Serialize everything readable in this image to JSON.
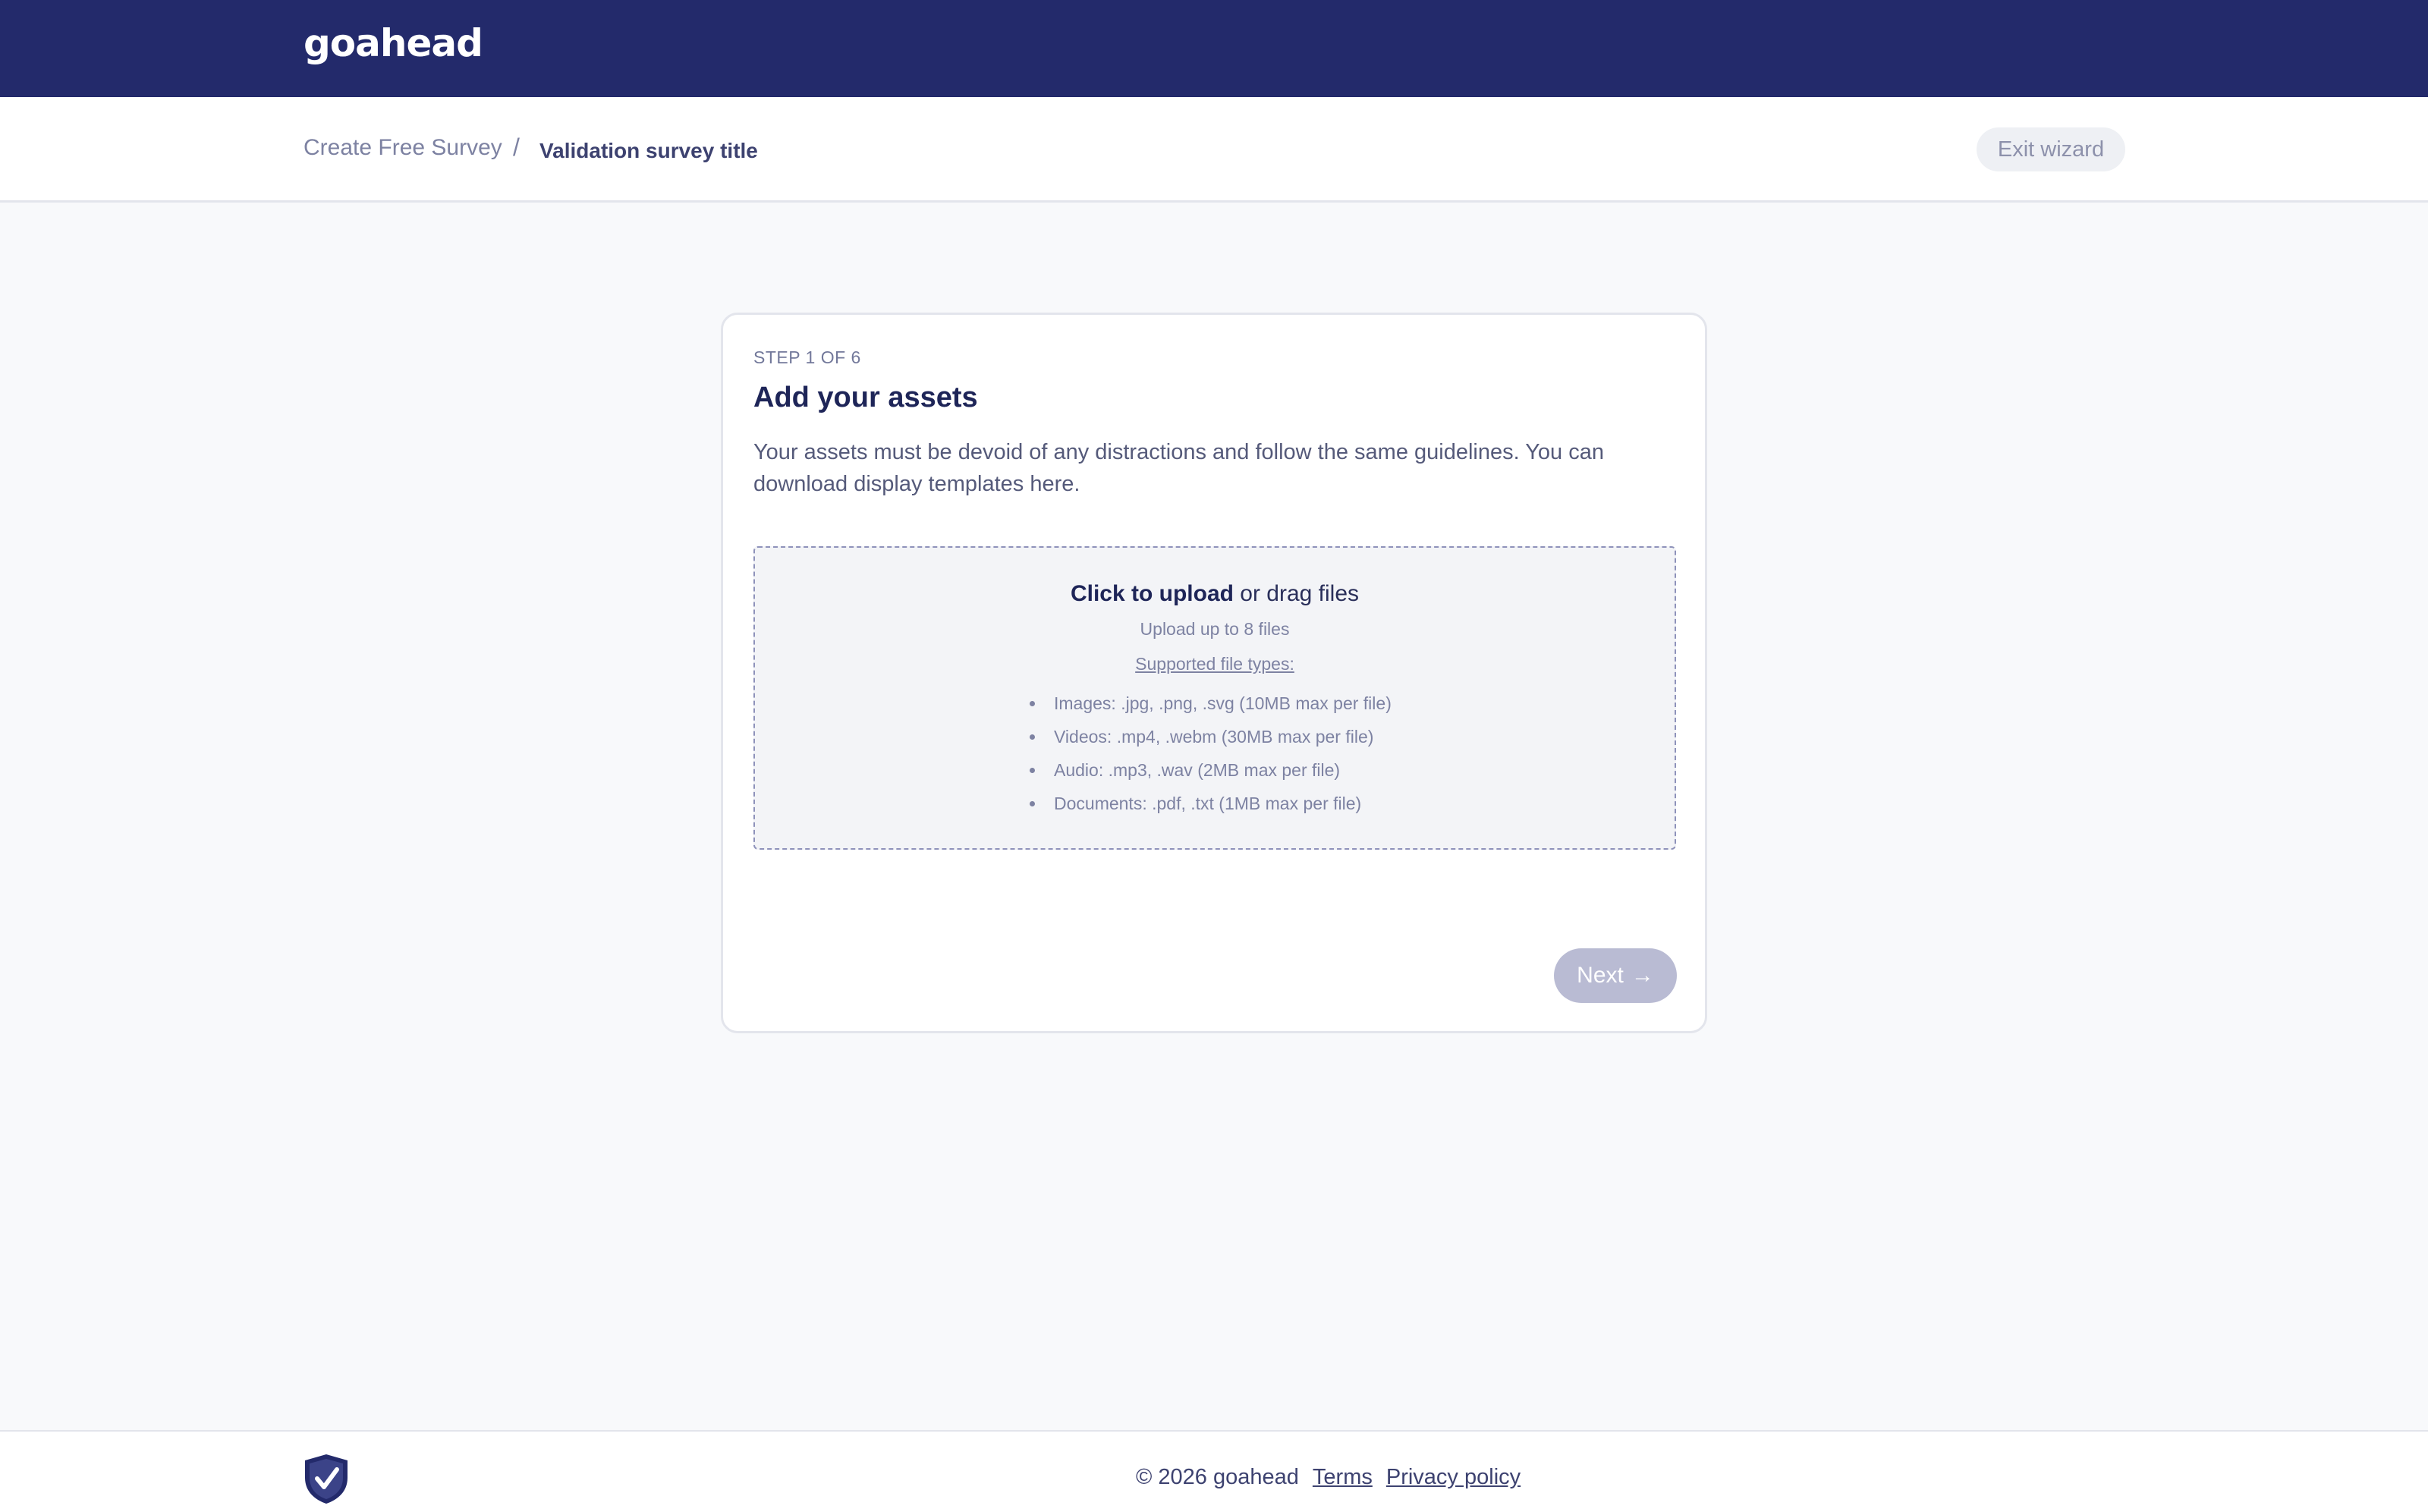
{
  "header": {
    "logo": "goahead"
  },
  "subheader": {
    "breadcrumb_link": "Create Free Survey",
    "breadcrumb_separator": "/",
    "breadcrumb_current": "Validation survey title",
    "exit_label": "Exit wizard"
  },
  "card": {
    "step": "STEP 1 OF 6",
    "title": "Add your assets",
    "description": "Your assets must be devoid of any distractions and follow the same guidelines. You can download display templates here.",
    "dropzone": {
      "click_text": "Click to upload",
      "drag_text": "or drag files",
      "limit": "Upload up to 8 files",
      "types_heading": "Supported file types:",
      "types": [
        "Images: .jpg, .png, .svg (10MB max per file)",
        "Videos: .mp4, .webm (30MB max per file)",
        "Audio: .mp3, .wav (2MB max per file)",
        "Documents: .pdf, .txt (1MB max per file)"
      ]
    },
    "next_label": "Next",
    "next_arrow": "→"
  },
  "footer": {
    "copyright": "© 2026 goahead",
    "terms": "Terms",
    "privacy": "Privacy policy",
    "badge_icon": "shield-check-icon"
  },
  "colors": {
    "header_bg": "#232a6b",
    "page_bg": "#f8f9fb",
    "primary_text": "#1e2558",
    "button_disabled": "#b9bbd3"
  }
}
